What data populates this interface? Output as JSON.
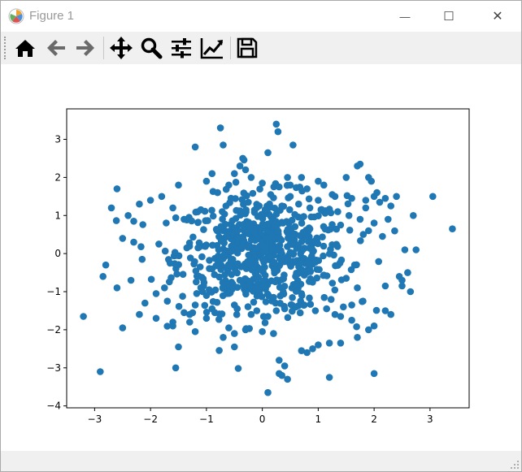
{
  "window": {
    "title": "Figure 1",
    "minimize_glyph": "—",
    "maximize_glyph": "☐",
    "close_glyph": "✕"
  },
  "toolbar": {
    "buttons": [
      {
        "name": "home-button",
        "icon": "home-icon"
      },
      {
        "name": "back-button",
        "icon": "arrow-left-icon"
      },
      {
        "name": "forward-button",
        "icon": "arrow-right-icon"
      },
      {
        "name": "pan-button",
        "icon": "move-icon"
      },
      {
        "name": "zoom-button",
        "icon": "magnifier-icon"
      },
      {
        "name": "subplots-button",
        "icon": "sliders-icon"
      },
      {
        "name": "edit-curves-button",
        "icon": "chart-line-icon"
      },
      {
        "name": "save-button",
        "icon": "floppy-disk-icon"
      }
    ]
  },
  "colors": {
    "marker": "#1f77b4",
    "toolbar_bg": "#f0f0f0",
    "title_text": "#999999"
  },
  "chart_data": {
    "type": "scatter",
    "title": "",
    "xlabel": "",
    "ylabel": "",
    "xlim": [
      -3.5,
      3.7
    ],
    "ylim": [
      -4.05,
      3.8
    ],
    "xticks": [
      -3,
      -2,
      -1,
      0,
      1,
      2,
      3
    ],
    "yticks": [
      -4,
      -3,
      -2,
      -1,
      0,
      1,
      2,
      3
    ],
    "xtick_labels": [
      "−3",
      "−2",
      "−1",
      "0",
      "1",
      "2",
      "3"
    ],
    "ytick_labels": [
      "−4",
      "−3",
      "−2",
      "−1",
      "0",
      "1",
      "2",
      "3"
    ],
    "grid": false,
    "series": [
      {
        "color": "#1f77b4",
        "x": [
          0.25,
          0.28,
          -0.75,
          -1.2,
          0.55,
          -0.7,
          -0.35,
          -0.3,
          -0.5,
          -0.4,
          0.1,
          0.45,
          -1.0,
          -0.9,
          -0.6,
          -0.2,
          0.0,
          0.3,
          0.5,
          0.7,
          0.8,
          1.0,
          1.1,
          1.3,
          1.5,
          1.7,
          1.75,
          1.9,
          1.95,
          2.0,
          -1.5,
          -1.8,
          -2.0,
          -2.2,
          -2.4,
          -2.6,
          -2.7,
          -2.5,
          -2.3,
          -3.2,
          -2.8,
          -2.9,
          -2.85,
          -2.6,
          -2.5,
          -2.2,
          -1.9,
          -1.6,
          -1.5,
          -1.3,
          -1.2,
          -1.0,
          -0.5,
          -0.7,
          -0.6,
          -0.3,
          0.0,
          0.2,
          0.3,
          0.35,
          0.45,
          0.7,
          0.8,
          0.9,
          1.0,
          1.2,
          1.4,
          1.7,
          1.9,
          2.0,
          2.2,
          2.3,
          2.5,
          2.65,
          2.75,
          2.6,
          2.55,
          3.05,
          3.4,
          2.7,
          2.4,
          2.2,
          2.05,
          1.85,
          -1.55,
          -1.6,
          0.1,
          0.3,
          0.4,
          1.2,
          2.0,
          -0.5,
          -1.4,
          -1.3,
          1.4,
          1.6,
          -2.1,
          -1.9,
          -1.7,
          -1.2,
          -1.0,
          -0.9,
          -0.85,
          -0.5,
          -0.45,
          -0.2,
          -0.1,
          0.1,
          0.25,
          0.4,
          0.6,
          0.75,
          0.95,
          1.15,
          1.3,
          1.45,
          1.6,
          1.8,
          2.2,
          2.45,
          2.5,
          -1.6,
          -0.8,
          0.15,
          0.5,
          1.0,
          1.25,
          1.6,
          1.85,
          2.1,
          2.3,
          -2.3,
          -1.4,
          -1.1,
          -0.65,
          -0.25,
          0.05,
          0.35,
          0.65,
          0.85,
          1.05,
          1.35,
          1.55,
          1.75,
          2.0,
          2.25,
          -1.05,
          -0.95,
          -0.4,
          0.6,
          0.9,
          1.7,
          -2.35,
          -1.75,
          1.5,
          1.4,
          0.85,
          -0.3,
          0.2,
          0.7,
          -0.15,
          -0.55,
          1.9,
          2.15,
          -2.15,
          -1.85,
          -1.35,
          0.55,
          0.95,
          1.65,
          -1.65,
          -1.15
        ],
        "y": [
          3.4,
          3.2,
          3.3,
          2.8,
          2.85,
          2.85,
          2.5,
          2.2,
          2.1,
          2.3,
          2.65,
          2.0,
          1.9,
          2.1,
          1.8,
          2.0,
          1.85,
          1.75,
          1.8,
          2.0,
          1.7,
          1.9,
          1.8,
          1.5,
          2.0,
          2.3,
          2.35,
          2.0,
          1.9,
          1.5,
          1.8,
          1.5,
          1.4,
          1.3,
          1.0,
          1.7,
          1.2,
          0.4,
          0.3,
          -1.65,
          -0.3,
          -3.1,
          -0.6,
          -0.9,
          -1.95,
          -1.6,
          -1.7,
          -1.8,
          -2.45,
          -1.6,
          -2.05,
          -1.7,
          -2.45,
          -2.2,
          -1.95,
          -2.0,
          -2.05,
          -2.1,
          -2.8,
          -3.2,
          -3.3,
          -2.55,
          -2.6,
          -2.5,
          -2.4,
          -2.35,
          -2.35,
          -2.2,
          -2.0,
          -1.9,
          -1.5,
          -1.6,
          -0.7,
          -1.0,
          0.1,
          -0.5,
          0.1,
          1.5,
          0.65,
          1.0,
          1.5,
          1.45,
          1.6,
          1.4,
          -3.0,
          -1.9,
          -3.65,
          -3.15,
          -2.95,
          -3.25,
          -3.15,
          -2.1,
          -1.55,
          -1.8,
          -1.65,
          -1.75,
          -1.3,
          -1.05,
          -1.25,
          -1.35,
          -1.1,
          -1.45,
          -1.55,
          -1.35,
          -1.45,
          -1.6,
          -1.5,
          -1.65,
          -1.5,
          -1.45,
          -1.4,
          -1.35,
          -1.5,
          -1.45,
          -1.6,
          -1.4,
          -1.35,
          -1.25,
          -0.85,
          -0.6,
          -0.85,
          1.2,
          1.6,
          1.55,
          1.5,
          1.4,
          1.55,
          1.45,
          1.2,
          1.35,
          1.25,
          0.85,
          0.9,
          1.15,
          1.25,
          1.35,
          1.15,
          1.25,
          1.3,
          1.2,
          1.15,
          1.1,
          1.0,
          0.9,
          0.8,
          0.9,
          -0.85,
          -0.95,
          -0.7,
          -0.8,
          -0.75,
          -0.9,
          -0.7,
          -0.9,
          -0.65,
          0.75,
          0.65,
          -1.0,
          -1.15,
          -1.05,
          0.55,
          -0.55,
          0.6,
          0.45,
          -0.15,
          0.25,
          0.15,
          -0.2,
          0.3,
          -0.3,
          -0.25,
          0.15
        ],
        "cluster": {
          "center": [
            0.0,
            0.0
          ],
          "sigma": 0.75,
          "count": 620
        }
      }
    ]
  }
}
